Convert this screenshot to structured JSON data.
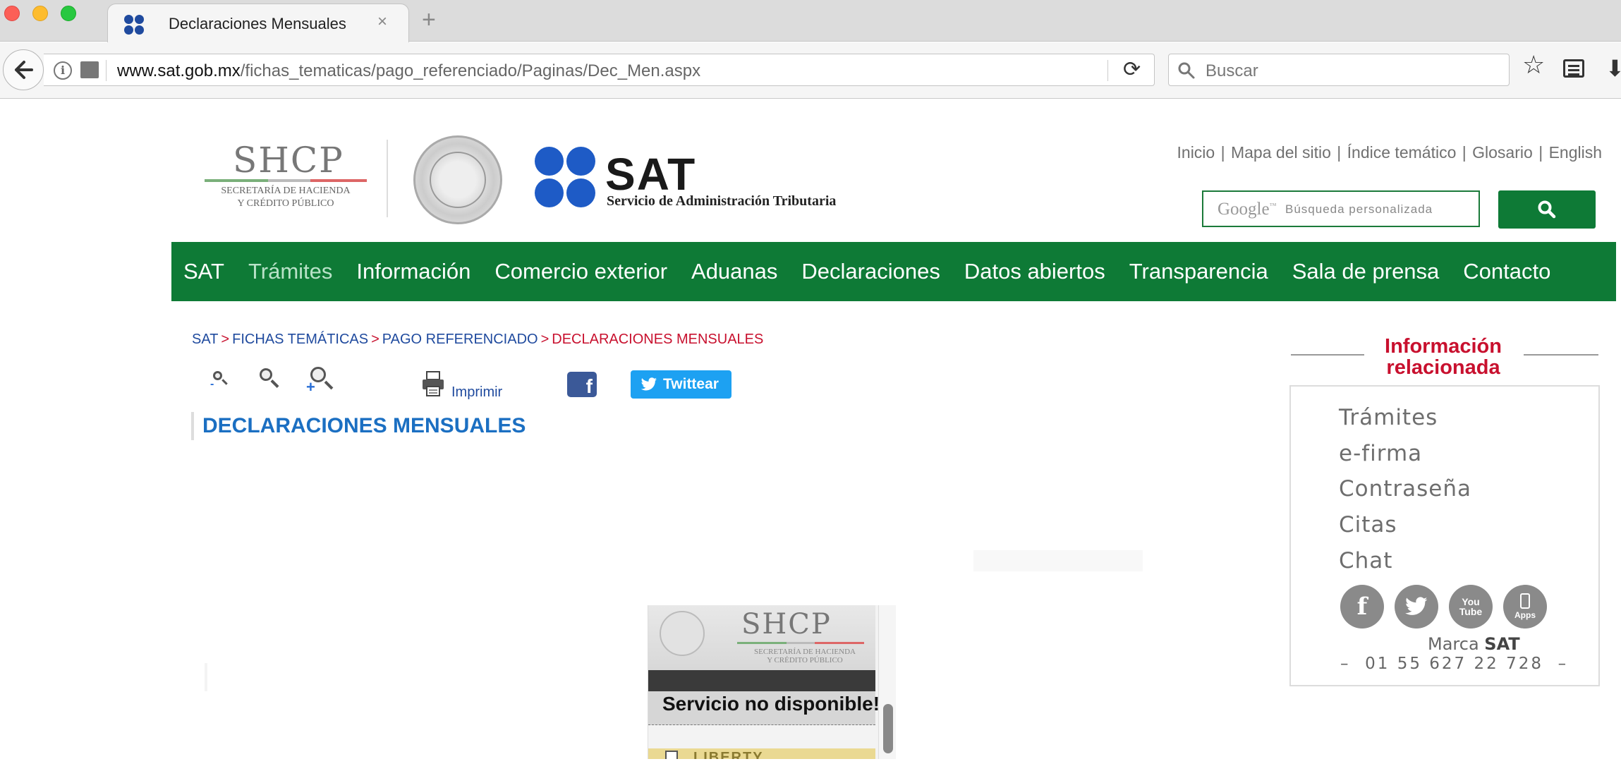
{
  "browser": {
    "tab_title": "Declaraciones Mensuales",
    "tab_close": "×",
    "new_tab": "+",
    "url_host": "www.sat.gob.mx",
    "url_path": "/fichas_tematicas/pago_referenciado/Paginas/Dec_Men.aspx",
    "search_placeholder": "Buscar"
  },
  "header": {
    "shcp_word": "SHCP",
    "shcp_sub_1": "SECRETARÍA DE HACIENDA",
    "shcp_sub_2": "Y CRÉDITO PÚBLICO",
    "sat_word": "SAT",
    "sat_sub": "Servicio de Administración Tributaria",
    "toplinks": [
      "Inicio",
      "Mapa del sitio",
      "Índice temático",
      "Glosario",
      "English"
    ],
    "google_label": "Google",
    "google_tm": "™",
    "search_placeholder": "Búsqueda personalizada"
  },
  "nav": {
    "items": [
      "SAT",
      "Trámites",
      "Información",
      "Comercio exterior",
      "Aduanas",
      "Declaraciones",
      "Datos abiertos",
      "Transparencia",
      "Sala de prensa",
      "Contacto"
    ],
    "active_index": 1
  },
  "breadcrumb": {
    "items": [
      "SAT",
      "FICHAS TEMÁTICAS",
      "PAGO REFERENCIADO"
    ],
    "current": "DECLARACIONES MENSUALES",
    "separator": ">"
  },
  "tools": {
    "print_label": "Imprimir",
    "facebook_glyph": "f",
    "tweet_label": "Twittear"
  },
  "main": {
    "page_title": "DECLARACIONES MENSUALES",
    "frame": {
      "header_word": "SHCP",
      "header_sub_1": "SECRETARÍA DE HACIENDA",
      "header_sub_2": "Y CRÉDITO PÚBLICO",
      "message": "Servicio no disponible!",
      "item_label": "LIBERTY"
    }
  },
  "sidebar": {
    "title_line1": "Información",
    "title_line2": "relacionada",
    "links": [
      "Trámites",
      "e-firma",
      "Contraseña",
      "Citas",
      "Chat"
    ],
    "social": [
      {
        "icon": "facebook-icon",
        "glyph": "f"
      },
      {
        "icon": "twitter-icon",
        "glyph": "t"
      },
      {
        "icon": "youtube-icon",
        "glyph": "You Tube"
      },
      {
        "icon": "apps-icon",
        "glyph": "Apps"
      }
    ],
    "marca_label": "Marca",
    "marca_brand": "SAT",
    "phone": "01 55 627 22 728",
    "phone_dash": "–"
  },
  "colors": {
    "nav_green": "#0e7a36",
    "link_blue": "#1f4a9e",
    "accent_red": "#c8102e",
    "title_blue": "#1b6fc2"
  }
}
